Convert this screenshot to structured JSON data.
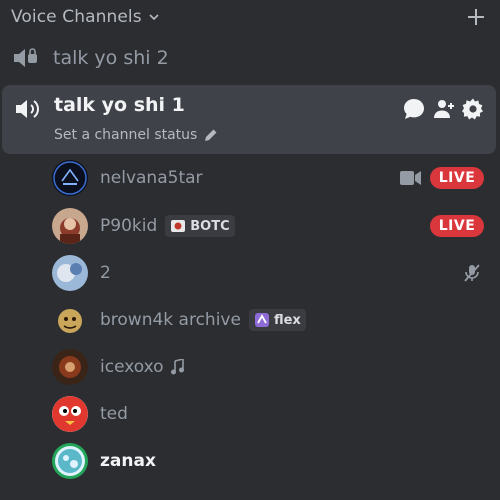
{
  "header": {
    "label": "Voice Channels",
    "chevron_icon": "chevron-down-icon",
    "add_icon": "plus-icon"
  },
  "channels": [
    {
      "name": "talk yo shi 2",
      "icon": "speaker-locked-icon"
    },
    {
      "name": "talk yo shi 1",
      "icon": "speaker-icon",
      "status_placeholder": "Set a channel status",
      "actions": [
        "chat-icon",
        "invite-icon",
        "gear-icon"
      ]
    }
  ],
  "users": [
    {
      "name": "nelvana5tar",
      "video": true,
      "live": "LIVE"
    },
    {
      "name": "P90kid",
      "tag": "BOTC",
      "live": "LIVE"
    },
    {
      "name": "2",
      "muted": true
    },
    {
      "name": "brown4k archive",
      "tag": "flex"
    },
    {
      "name": "icexoxo",
      "activity_icon": "music-note-icon"
    },
    {
      "name": "ted"
    },
    {
      "name": "zanax",
      "speaking": true
    }
  ],
  "colors": {
    "background": "#2b2d31",
    "active_row": "#404249",
    "live": "#da373c",
    "speaking_ring": "#23a55a"
  }
}
